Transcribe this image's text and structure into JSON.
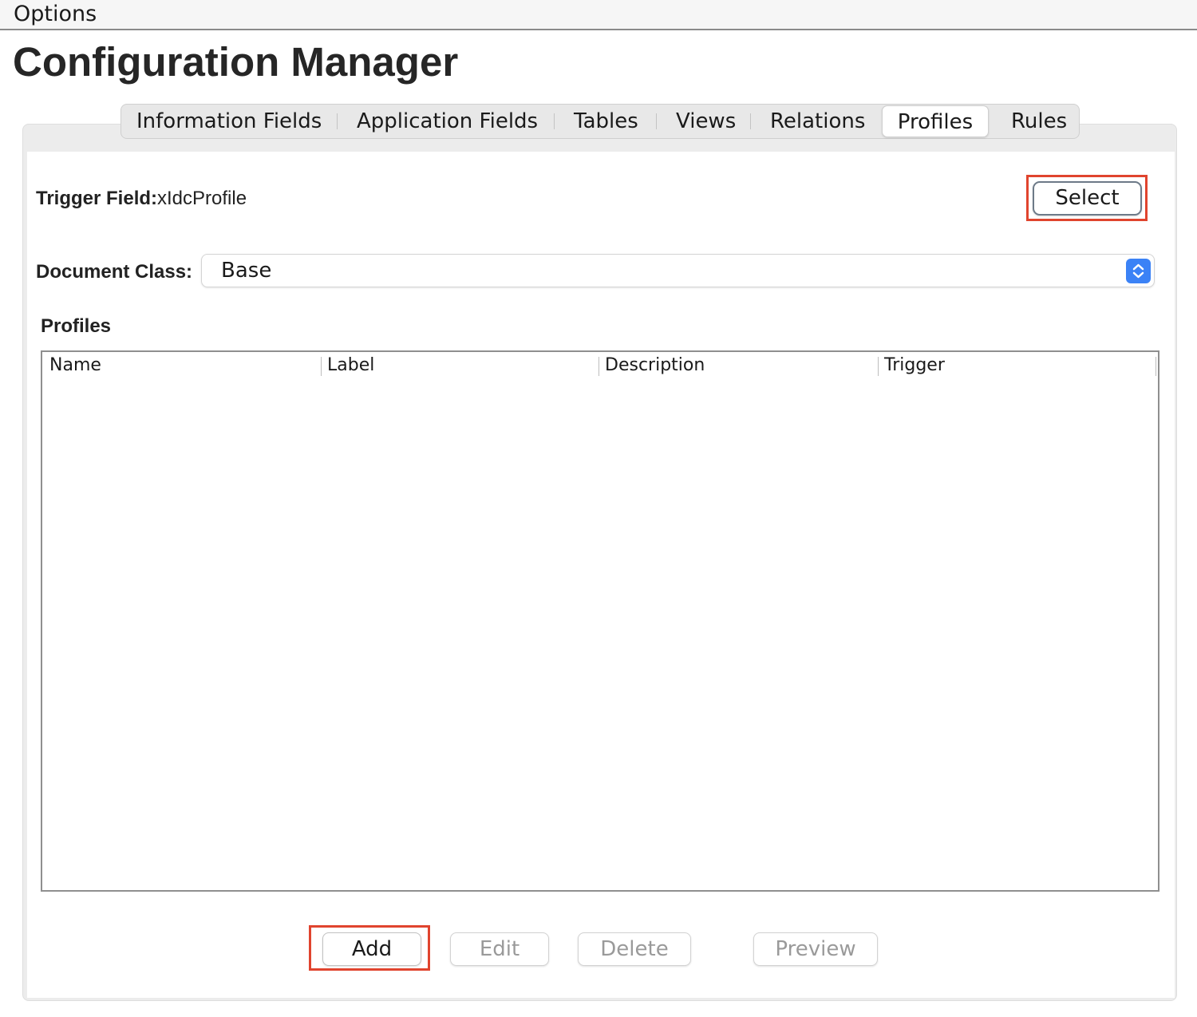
{
  "menubar": {
    "menu_label": "Options"
  },
  "page": {
    "title": "Configuration Manager"
  },
  "tabs": [
    {
      "label": "Information Fields",
      "active": false
    },
    {
      "label": "Application Fields",
      "active": false
    },
    {
      "label": "Tables",
      "active": false
    },
    {
      "label": "Views",
      "active": false
    },
    {
      "label": "Relations",
      "active": false
    },
    {
      "label": "Profiles",
      "active": true
    },
    {
      "label": "Rules",
      "active": false
    }
  ],
  "trigger_field": {
    "label": "Trigger Field:",
    "value": "xIdcProfile",
    "select_button": "Select"
  },
  "document_class": {
    "label": "Document Class:",
    "selected": "Base"
  },
  "profiles": {
    "section_title": "Profiles",
    "columns": [
      "Name",
      "Label",
      "Description",
      "Trigger"
    ],
    "rows": []
  },
  "actions": {
    "add": {
      "label": "Add",
      "enabled": true
    },
    "edit": {
      "label": "Edit",
      "enabled": false
    },
    "delete": {
      "label": "Delete",
      "enabled": false
    },
    "preview": {
      "label": "Preview",
      "enabled": false
    }
  },
  "colors": {
    "highlight": "#e0442e",
    "dropdown_accent": "#3b82f6"
  }
}
